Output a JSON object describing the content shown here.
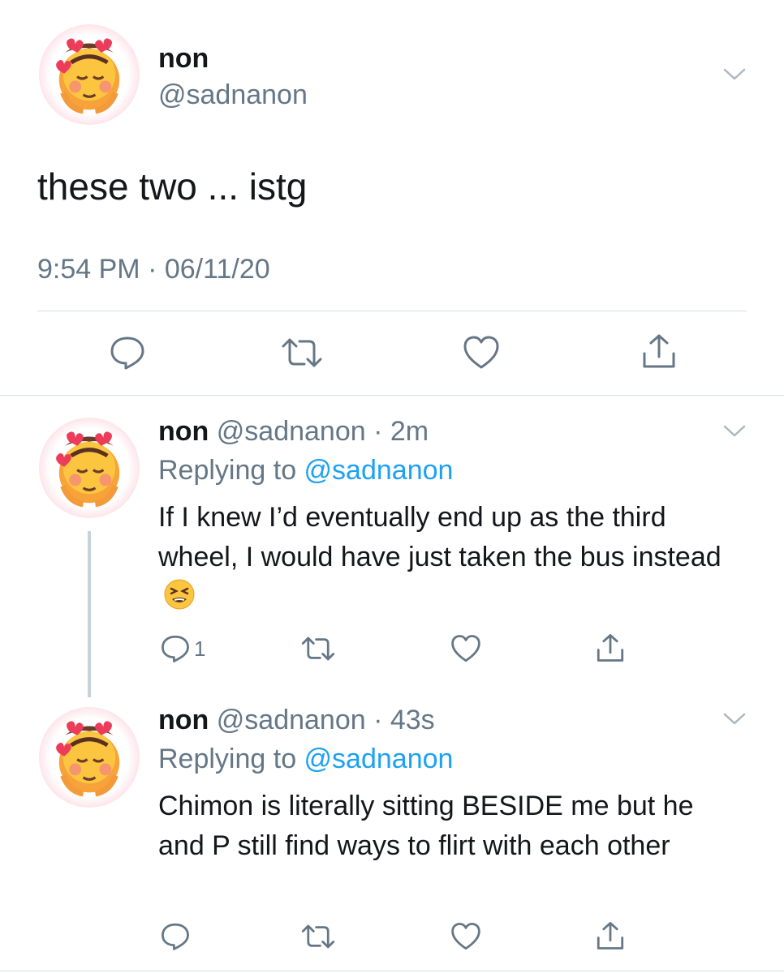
{
  "main_tweet": {
    "name": "non",
    "handle": "@sadnanon",
    "text": "these two ... istg",
    "timestamp": "9:54 PM · 06/11/20",
    "avatar": "blushing-emoji-with-hearts-avatar",
    "actions": [
      "reply-icon",
      "retweet-icon",
      "like-icon",
      "share-icon"
    ]
  },
  "replies": [
    {
      "name": "non",
      "handle_time": "@sadnanon · 2m",
      "replying_label": "Replying to ",
      "replying_to": "@sadnanon",
      "text": "If I knew I’d eventually end up as the third wheel, I would have just taken the bus instead",
      "trailing_emoji": "tired-face-emoji",
      "reply_count": "1"
    },
    {
      "name": "non",
      "handle_time": "@sadnanon · 43s",
      "replying_label": "Replying to ",
      "replying_to": "@sadnanon",
      "text": "Chimon is literally sitting BESIDE me but he and P still find ways to flirt with each other",
      "reply_count": ""
    }
  ],
  "colors": {
    "text": "#14171a",
    "secondary": "#657786",
    "link": "#1da1f2",
    "divider": "#d5dde3"
  }
}
